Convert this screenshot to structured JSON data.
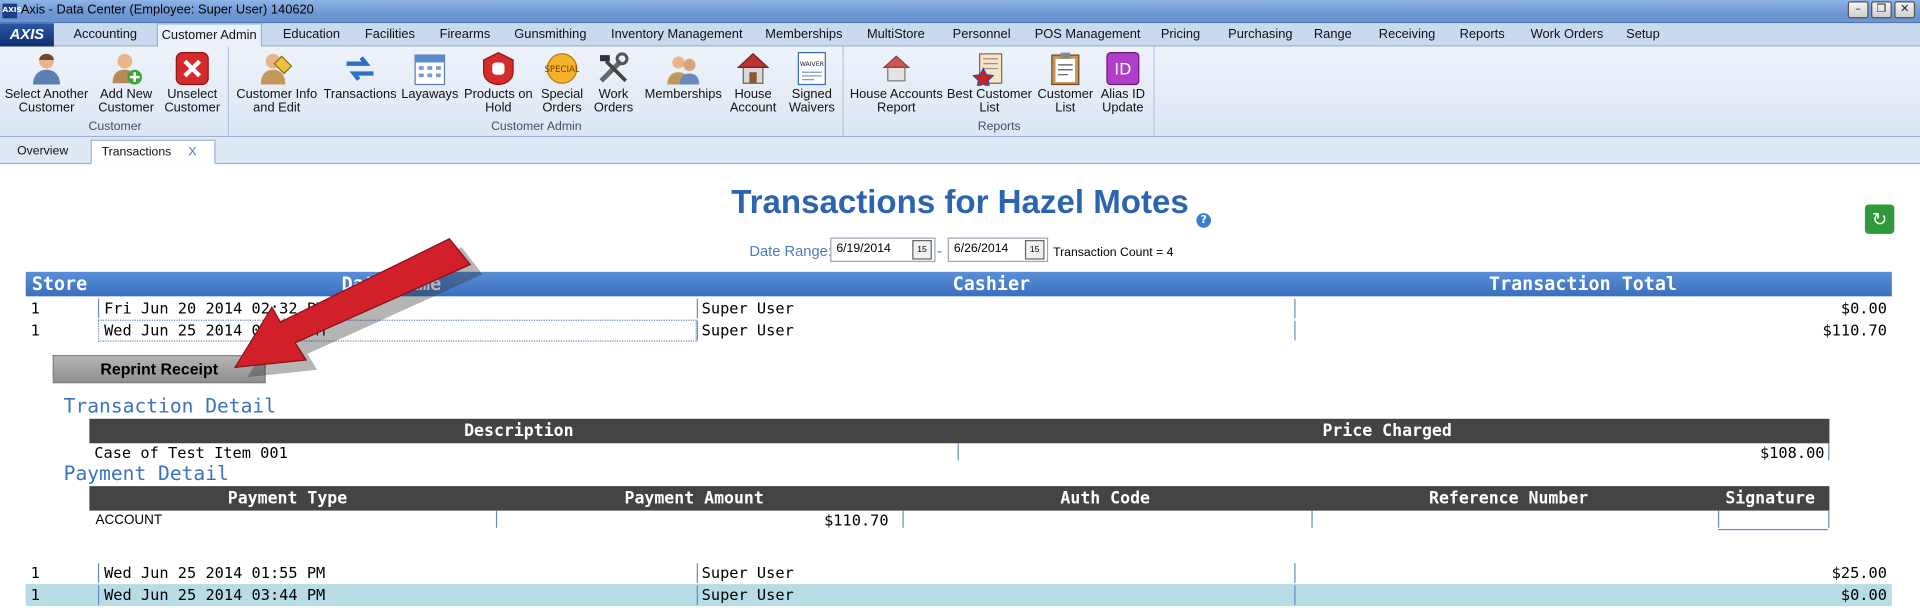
{
  "window": {
    "app_icon": "AXIS",
    "title": "Axis - Data Center  (Employee: Super User) 140620",
    "buttons": [
      "minimize-icon",
      "restore-icon",
      "close-icon"
    ]
  },
  "logo": "AXIS",
  "menu_tabs": [
    "Accounting",
    "Customer Admin",
    "Education",
    "Facilities",
    "Firearms",
    "Gunsmithing",
    "Inventory Management",
    "Memberships",
    "MultiStore",
    "Personnel",
    "POS Management",
    "Pricing",
    "Purchasing",
    "Range",
    "Receiving",
    "Reports",
    "Work Orders",
    "Setup"
  ],
  "active_menu_tab": "Customer Admin",
  "ribbon": {
    "groups": [
      {
        "label": "Customer",
        "buttons": [
          {
            "l1": "Select Another",
            "l2": "Customer",
            "icon": "person-icon"
          },
          {
            "l1": "Add New",
            "l2": "Customer",
            "icon": "add-person-icon"
          },
          {
            "l1": "Unselect",
            "l2": "Customer",
            "icon": "red-x-icon"
          }
        ]
      },
      {
        "label": "Customer Admin",
        "buttons": [
          {
            "l1": "Customer Info",
            "l2": "and Edit",
            "icon": "person-edit-icon"
          },
          {
            "l1": "Transactions",
            "l2": "",
            "icon": "transactions-arrows-icon"
          },
          {
            "l1": "Layaways",
            "l2": "",
            "icon": "calendar-icon"
          },
          {
            "l1": "Products on",
            "l2": "Hold",
            "icon": "hold-hand-icon"
          },
          {
            "l1": "Special",
            "l2": "Orders",
            "icon": "special-tag-icon"
          },
          {
            "l1": "Work",
            "l2": "Orders",
            "icon": "tools-icon"
          },
          {
            "l1": "Memberships",
            "l2": "",
            "icon": "people-icon"
          },
          {
            "l1": "House",
            "l2": "Account",
            "icon": "house-icon"
          },
          {
            "l1": "Signed",
            "l2": "Waivers",
            "icon": "waiver-document-icon"
          }
        ]
      },
      {
        "label": "Reports",
        "buttons": [
          {
            "l1": "House Accounts",
            "l2": "Report",
            "icon": "house-report-icon"
          },
          {
            "l1": "Best Customer",
            "l2": "List",
            "icon": "star-list-icon"
          },
          {
            "l1": "Customer",
            "l2": "List",
            "icon": "clipboard-list-icon"
          },
          {
            "l1": "Alias ID",
            "l2": "Update",
            "icon": "id-badge-icon"
          }
        ]
      }
    ]
  },
  "doc_tabs": {
    "overview": "Overview",
    "transactions": "Transactions",
    "close": "X"
  },
  "page": {
    "title": "Transactions for Hazel Motes",
    "help": "?",
    "refresh_icon": "refresh-icon",
    "date_range_label": "Date Range:",
    "date_from": "6/19/2014",
    "date_to": "6/26/2014",
    "cal_label": "15",
    "date_sep": "-",
    "transaction_count": "Transaction Count = 4"
  },
  "table": {
    "headers": {
      "store": "Store",
      "datetime": "Date/Time",
      "cashier": "Cashier",
      "total": "Transaction Total"
    },
    "rows": [
      {
        "store": "1",
        "datetime": "Fri Jun 20 2014 02:32 PM",
        "cashier": "Super User",
        "total": "$0.00"
      },
      {
        "store": "1",
        "datetime": "Wed Jun 25 2014 01:03 PM",
        "cashier": "Super User",
        "total": "$110.70"
      },
      {
        "store": "1",
        "datetime": "Wed Jun 25 2014 01:55 PM",
        "cashier": "Super User",
        "total": "$25.00"
      },
      {
        "store": "1",
        "datetime": "Wed Jun 25 2014 03:44 PM",
        "cashier": "Super User",
        "total": "$0.00"
      }
    ],
    "selected_row_index": 3
  },
  "detail": {
    "reprint_button": "Reprint Receipt",
    "transaction_detail_title": "Transaction Detail",
    "transaction_headers": {
      "description": "Description",
      "price": "Price Charged"
    },
    "transaction_rows": [
      {
        "description": "Case of Test Item 001",
        "price": "$108.00"
      }
    ],
    "payment_detail_title": "Payment Detail",
    "payment_headers": {
      "type": "Payment Type",
      "amount": "Payment Amount",
      "auth": "Auth Code",
      "ref": "Reference Number",
      "signature": "Signature"
    },
    "payment_rows": [
      {
        "type": "ACCOUNT",
        "amount": "$110.70",
        "auth": "",
        "ref": "",
        "signature": ""
      }
    ]
  },
  "annotation": {
    "arrow_color": "#d1202a"
  }
}
